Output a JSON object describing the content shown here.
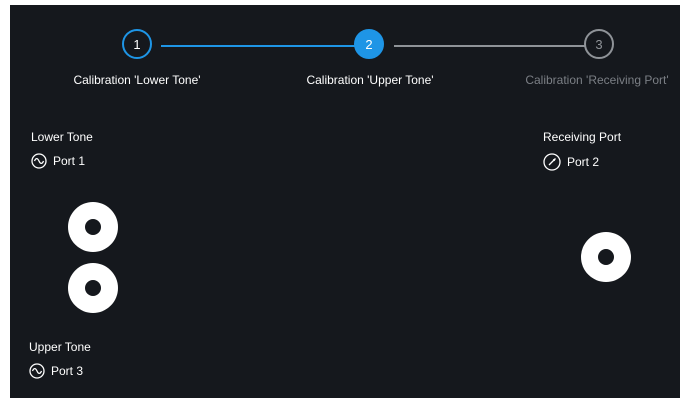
{
  "wizard": {
    "steps": [
      {
        "number": "1",
        "label": "Calibration 'Lower Tone'",
        "state": "done"
      },
      {
        "number": "2",
        "label": "Calibration 'Upper Tone'",
        "state": "active"
      },
      {
        "number": "3",
        "label": "Calibration 'Receiving Port'",
        "state": "todo"
      }
    ]
  },
  "lower_tone": {
    "title": "Lower Tone",
    "port": "Port 1",
    "icon": "sine-wave-icon"
  },
  "upper_tone": {
    "title": "Upper Tone",
    "port": "Port 3",
    "icon": "sine-wave-icon"
  },
  "receiving_port": {
    "title": "Receiving Port",
    "port": "Port 2",
    "icon": "meter-needle-icon"
  },
  "colors": {
    "background": "#15181d",
    "accent": "#1e95e6",
    "inactive": "#8f9398",
    "text": "#ffffff"
  }
}
